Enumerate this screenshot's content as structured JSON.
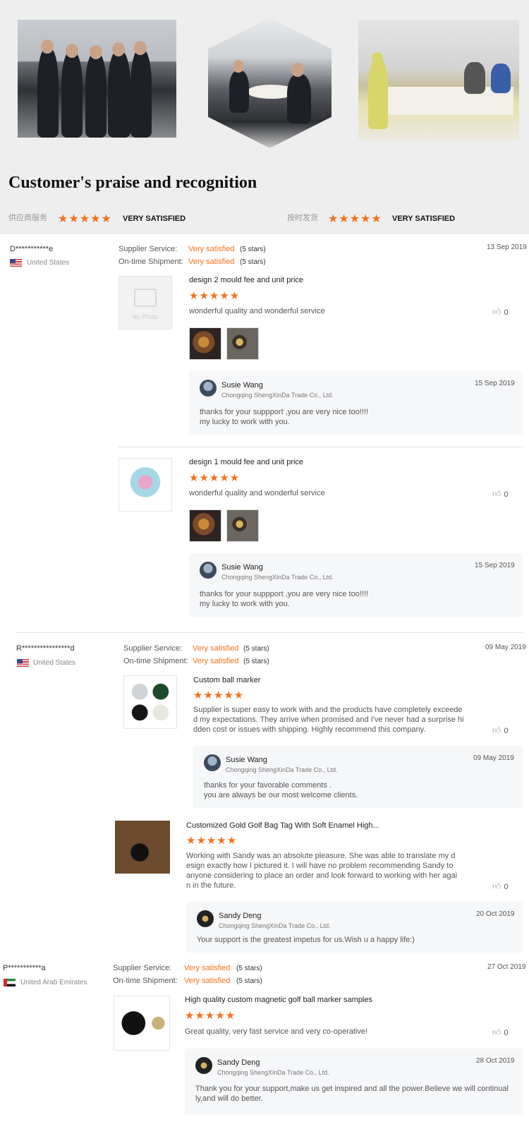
{
  "header": {
    "title": "Customer's praise and recognition",
    "overview": [
      {
        "label": "供应商服务",
        "stars": "★★★★★",
        "rating": "VERY SATISFIED"
      },
      {
        "label": "按时发货",
        "stars": "★★★★★",
        "rating": "VERY SATISFIED"
      }
    ]
  },
  "labels": {
    "supplier_service": "Supplier Service:",
    "ontime_shipment": "On-time Shipment:",
    "no_photo": "No Photo"
  },
  "reviews": [
    {
      "buyer": "D***********e",
      "country": "United States",
      "date": "13 Sep 2019",
      "supplier_rating": "Very satisfied",
      "supplier_stars": "(5 stars)",
      "shipment_rating": "Very satisfied",
      "shipment_stars": "(5 stars)",
      "items": [
        {
          "title": "design 2 mould fee and unit price",
          "stars": "★★★★★",
          "text": "wonderful quality and wonderful service",
          "likes": "0",
          "reply": {
            "name": "Susie Wang",
            "company": "Chongqing ShengXinDa Trade Co., Ltd.",
            "date": "15 Sep 2019",
            "line1": "thanks for your suppport ,you are very nice too!!!!",
            "line2": "my lucky to work with you."
          }
        },
        {
          "title": "design 1 mould fee and unit price",
          "stars": "★★★★★",
          "text": "wonderful quality and wonderful service",
          "likes": "0",
          "reply": {
            "name": "Susie Wang",
            "company": "Chongqing ShengXinDa Trade Co., Ltd.",
            "date": "15 Sep 2019",
            "line1": "thanks for your suppport ,you are very nice too!!!!",
            "line2": "my lucky to work with you."
          }
        }
      ]
    },
    {
      "buyer": "R****************d",
      "country": "United States",
      "date": "09 May 2019",
      "supplier_rating": "Very satisfied",
      "supplier_stars": "(5 stars)",
      "shipment_rating": "Very satisfied",
      "shipment_stars": "(5 stars)",
      "items": [
        {
          "title": "Custom ball marker",
          "stars": "★★★★★",
          "text_lines": [
            "Supplier is super easy to work with and the products have completely exceede",
            "d my expectations. They arrive when promised and I've never had a surprise hi",
            "dden cost or issues with shipping. Highly recommend this company."
          ],
          "likes": "0",
          "reply": {
            "name": "Susie Wang",
            "company": "Chongqing ShengXinDa Trade Co., Ltd.",
            "date": "09 May 2019",
            "line1": "thanks for your favorable comments .",
            "line2": "you are always be our most welcome clients."
          }
        },
        {
          "title": "Customized Gold Golf Bag Tag With Soft Enamel High...",
          "stars": "★★★★★",
          "text_lines": [
            "Working with Sandy was an absolute pleasure. She was able to translate my d",
            "esign exactly how I pictured it. I will have no problem recommending Sandy to",
            "anyone considering to place an order and look forward to working with her agai",
            "n in the future."
          ],
          "likes": "0",
          "reply": {
            "name": "Sandy Deng",
            "company": "Chongqing ShengXinDa Trade Co., Ltd.",
            "date": "20 Oct 2019",
            "line1": "Your support is the greatest impetus for us.Wish u a happy life:)"
          }
        }
      ]
    },
    {
      "buyer": "P***********a",
      "country": "United Arab Emirates",
      "date": "27 Oct 2019",
      "supplier_rating": "Very satisfied",
      "supplier_stars": "(5 stars)",
      "shipment_rating": "Very satisfied",
      "shipment_stars": "(5 stars)",
      "items": [
        {
          "title": "High quality custom magnetic golf ball marker samples",
          "stars": "★★★★★",
          "text": "Great quality, very fast service and very co-operative!",
          "likes": "0",
          "reply": {
            "name": "Sandy Deng",
            "company": "Chongqing ShengXinDa Trade Co., Ltd.",
            "date": "28 Oct 2019",
            "line1": "Thank you for your support,make us get inspired and all the power.Believe we will continual",
            "line2": "ly,and will do better."
          }
        }
      ]
    }
  ],
  "colors": {
    "accent": "#f5701a",
    "reply_bg": "#f6f7f9",
    "top_bg": "#eeeeee"
  }
}
